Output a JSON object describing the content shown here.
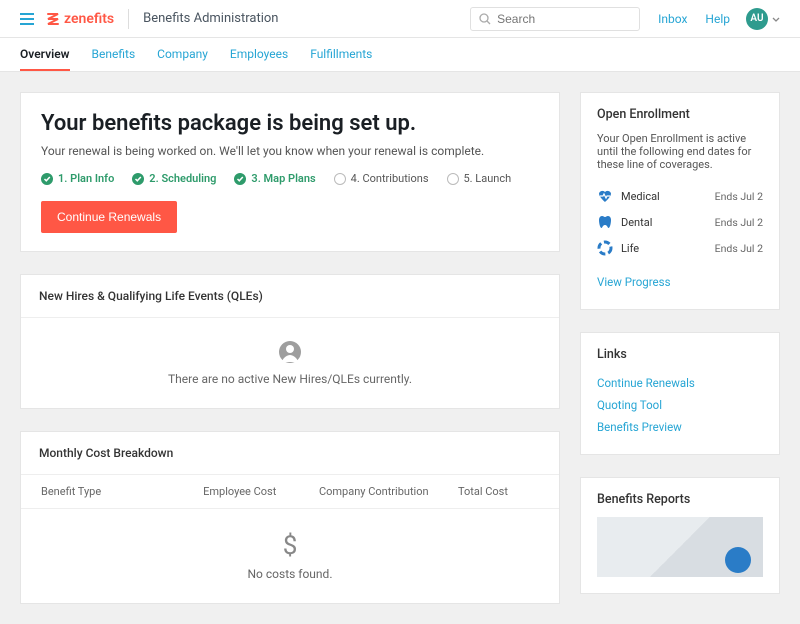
{
  "header": {
    "brand": "zenefits",
    "app_title": "Benefits Administration",
    "search_placeholder": "Search",
    "inbox": "Inbox",
    "help": "Help",
    "avatar_initials": "AU"
  },
  "tabs": [
    {
      "label": "Overview",
      "active": true
    },
    {
      "label": "Benefits",
      "active": false
    },
    {
      "label": "Company",
      "active": false
    },
    {
      "label": "Employees",
      "active": false
    },
    {
      "label": "Fulfillments",
      "active": false
    }
  ],
  "hero": {
    "title": "Your benefits package is being set up.",
    "subtitle": "Your renewal is being worked on. We'll let you know when your renewal is complete.",
    "steps": [
      {
        "label": "1. Plan Info",
        "done": true
      },
      {
        "label": "2. Scheduling",
        "done": true
      },
      {
        "label": "3. Map Plans",
        "done": true
      },
      {
        "label": "4. Contributions",
        "done": false
      },
      {
        "label": "5. Launch",
        "done": false
      }
    ],
    "cta": "Continue Renewals"
  },
  "qle": {
    "title": "New Hires & Qualifying Life Events (QLEs)",
    "empty": "There are no active New Hires/QLEs currently."
  },
  "costs": {
    "title": "Monthly Cost Breakdown",
    "headers": [
      "Benefit Type",
      "Employee Cost",
      "Company Contribution",
      "Total Cost"
    ],
    "empty": "No costs found."
  },
  "open_enrollment": {
    "title": "Open Enrollment",
    "desc": "Your Open Enrollment is active until the following end dates for these line of coverages.",
    "coverages": [
      {
        "name": "Medical",
        "ends": "Ends Jul 2",
        "icon": "heart"
      },
      {
        "name": "Dental",
        "ends": "Ends Jul 2",
        "icon": "tooth"
      },
      {
        "name": "Life",
        "ends": "Ends Jul 2",
        "icon": "ring"
      }
    ],
    "view_progress": "View Progress"
  },
  "links_card": {
    "title": "Links",
    "items": [
      "Continue Renewals",
      "Quoting Tool",
      "Benefits Preview"
    ]
  },
  "reports": {
    "title": "Benefits Reports"
  }
}
